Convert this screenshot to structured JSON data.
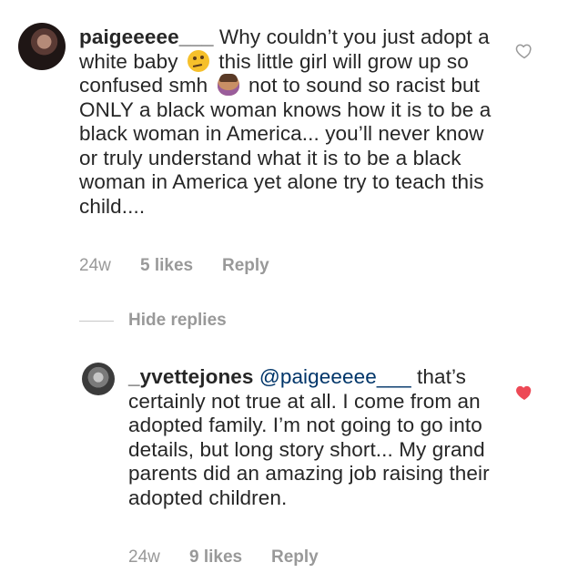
{
  "comment": {
    "username": "paigeeeee___",
    "text_part1": "Why couldn’t you just adopt a white baby",
    "emoji1": "thinking-face-icon",
    "text_part2": "this little girl will grow up so confused smh",
    "emoji2": "facepalm-icon",
    "text_part3": "not to sound so racist but ONLY a black woman knows how it is to be a black woman in America... you’ll never know or truly understand what it is to be a black woman in America yet alone try to teach this child....",
    "time": "24w",
    "likes": "5 likes",
    "reply": "Reply",
    "liked": false
  },
  "hide_replies": "Hide replies",
  "reply": {
    "username": "_yvettejones",
    "mention": "@paigeeeee___",
    "text": "that’s certainly not true at all. I come from an adopted family. I’m not going to go into details, but long story short... My grand parents did an amazing job raising their adopted children.",
    "time": "24w",
    "likes": "9 likes",
    "reply": "Reply",
    "liked": true
  },
  "colors": {
    "text": "#262626",
    "meta": "#999999",
    "mention": "#003569",
    "heart_liked": "#ed4956",
    "heart_outline": "#999999"
  }
}
